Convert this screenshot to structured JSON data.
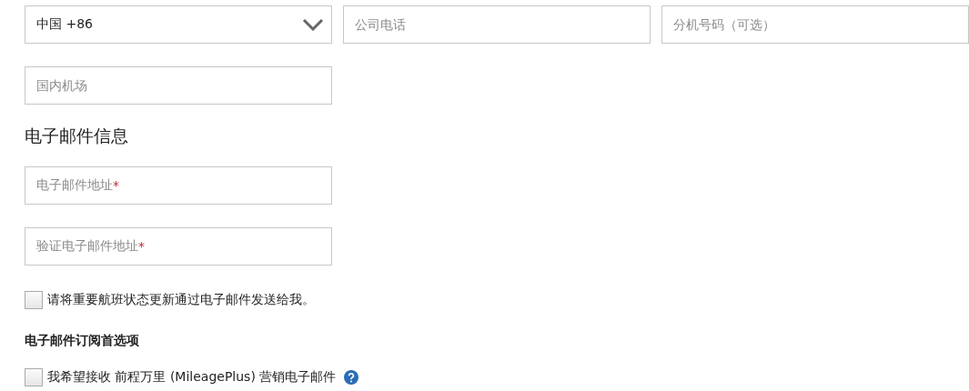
{
  "phone_row": {
    "country_select": {
      "value": "中国 +86"
    },
    "phone_field": {
      "placeholder": "公司电话"
    },
    "extension_field": {
      "placeholder": "分机号码（可选）"
    }
  },
  "airport_field": {
    "placeholder": "国内机场"
  },
  "email_section": {
    "title": "电子邮件信息",
    "fields": [
      {
        "placeholder": "电子邮件地址",
        "required_mark": "*"
      },
      {
        "placeholder": "验证电子邮件地址",
        "required_mark": "*"
      }
    ],
    "status_updates": {
      "label": "请将重要航班状态更新通过电子邮件发送给我。",
      "checked": false
    }
  },
  "subscription_section": {
    "title": "电子邮件订阅首选项",
    "options": [
      {
        "label": "我希望接收 前程万里 (MileagePlus) 营销电子邮件",
        "checked": false,
        "help": true
      }
    ]
  }
}
